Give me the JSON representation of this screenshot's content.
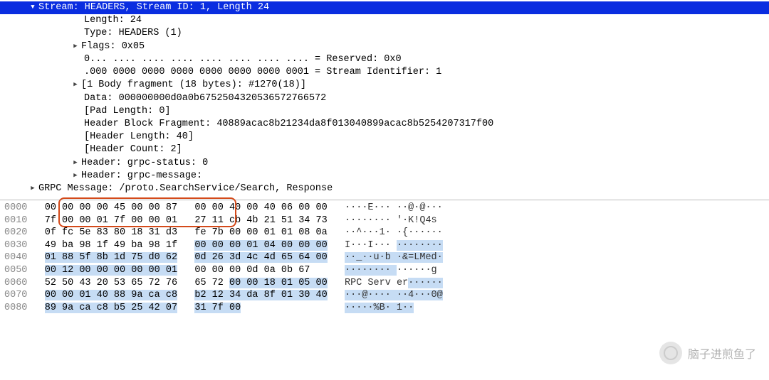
{
  "tree": {
    "stream_header": "Stream: HEADERS, Stream ID: 1, Length 24",
    "length": "Length: 24",
    "type": "Type: HEADERS (1)",
    "flags": "Flags: 0x05",
    "reserved": "0... .... .... .... .... .... .... .... = Reserved: 0x0",
    "stream_id": ".000 0000 0000 0000 0000 0000 0000 0001 = Stream Identifier: 1",
    "body_frag": "[1 Body fragment (18 bytes): #1270(18)]",
    "data": "Data: 000000000d0a0b6752504320536572766572",
    "pad_len": "[Pad Length: 0]",
    "hbf": "Header Block Fragment: 40889acac8b21234da8f013040899acac8b5254207317f00",
    "hlen": "[Header Length: 40]",
    "hcount": "[Header Count: 2]",
    "hdr_status": "Header: grpc-status: 0",
    "hdr_message": "Header: grpc-message:",
    "grpc_msg": "GRPC Message: /proto.SearchService/Search, Response"
  },
  "hex": {
    "rows": [
      {
        "off": "0000",
        "b1": "00 00 00 00 45 00 00 87",
        "b2": "00 00 40 00 40 06 00 00",
        "a": "····E··· ··@·@···"
      },
      {
        "off": "0010",
        "b1": "7f 00 00 01 7f 00 00 01",
        "b2": "27 11 cb 4b 21 51 34 73",
        "a": "········ '·K!Q4s"
      },
      {
        "off": "0020",
        "b1": "0f fc 5e 83 80 18 31 d3",
        "b2": "fe 7b 00 00 01 01 08 0a",
        "a": "··^···1· ·{······"
      },
      {
        "off": "0030",
        "b1": "49 ba 98 1f 49 ba 98 1f",
        "b2_pre": "",
        "b2_hl": "00 00 00 01 04 00 00 00",
        "a_pre": "I···I··· ",
        "a_hl": "········"
      },
      {
        "off": "0040",
        "b1_hl": "01 88 5f 8b 1d 75 d0 62",
        "b2_hl": "0d 26 3d 4c 4d 65 64 00",
        "a_hl_1": "··_··u·b ·&=LMed·"
      },
      {
        "off": "0050",
        "b1_hl": "00 12 00 00 00 00 00 01",
        "b2_pre_hl": "",
        "b2_plain": "00 00 00 0d 0a 0b 67",
        "a_hl_1": "········ ",
        "a_plain": "······g"
      },
      {
        "off": "0060",
        "b1_plain": "52 50 43 20 53 65 72 76",
        "b2_plain_pre": "65 72 ",
        "b2_hl": "00 00 18 01 05 00",
        "a_plain": "RPC Serv er",
        "a_hl": "······"
      },
      {
        "off": "0070",
        "b1_hl": "00 00 01 40 88 9a ca c8",
        "b2_hl": "b2 12 34 da 8f 01 30 40",
        "a_hl": "···@···· ··4···0@"
      },
      {
        "off": "0080",
        "b1_hl": "89 9a ca c8 b5 25 42 07",
        "b2_hl": "31 7f 00",
        "a_hl": "·····%B· 1··"
      }
    ]
  },
  "watermark": "脑子进煎鱼了"
}
